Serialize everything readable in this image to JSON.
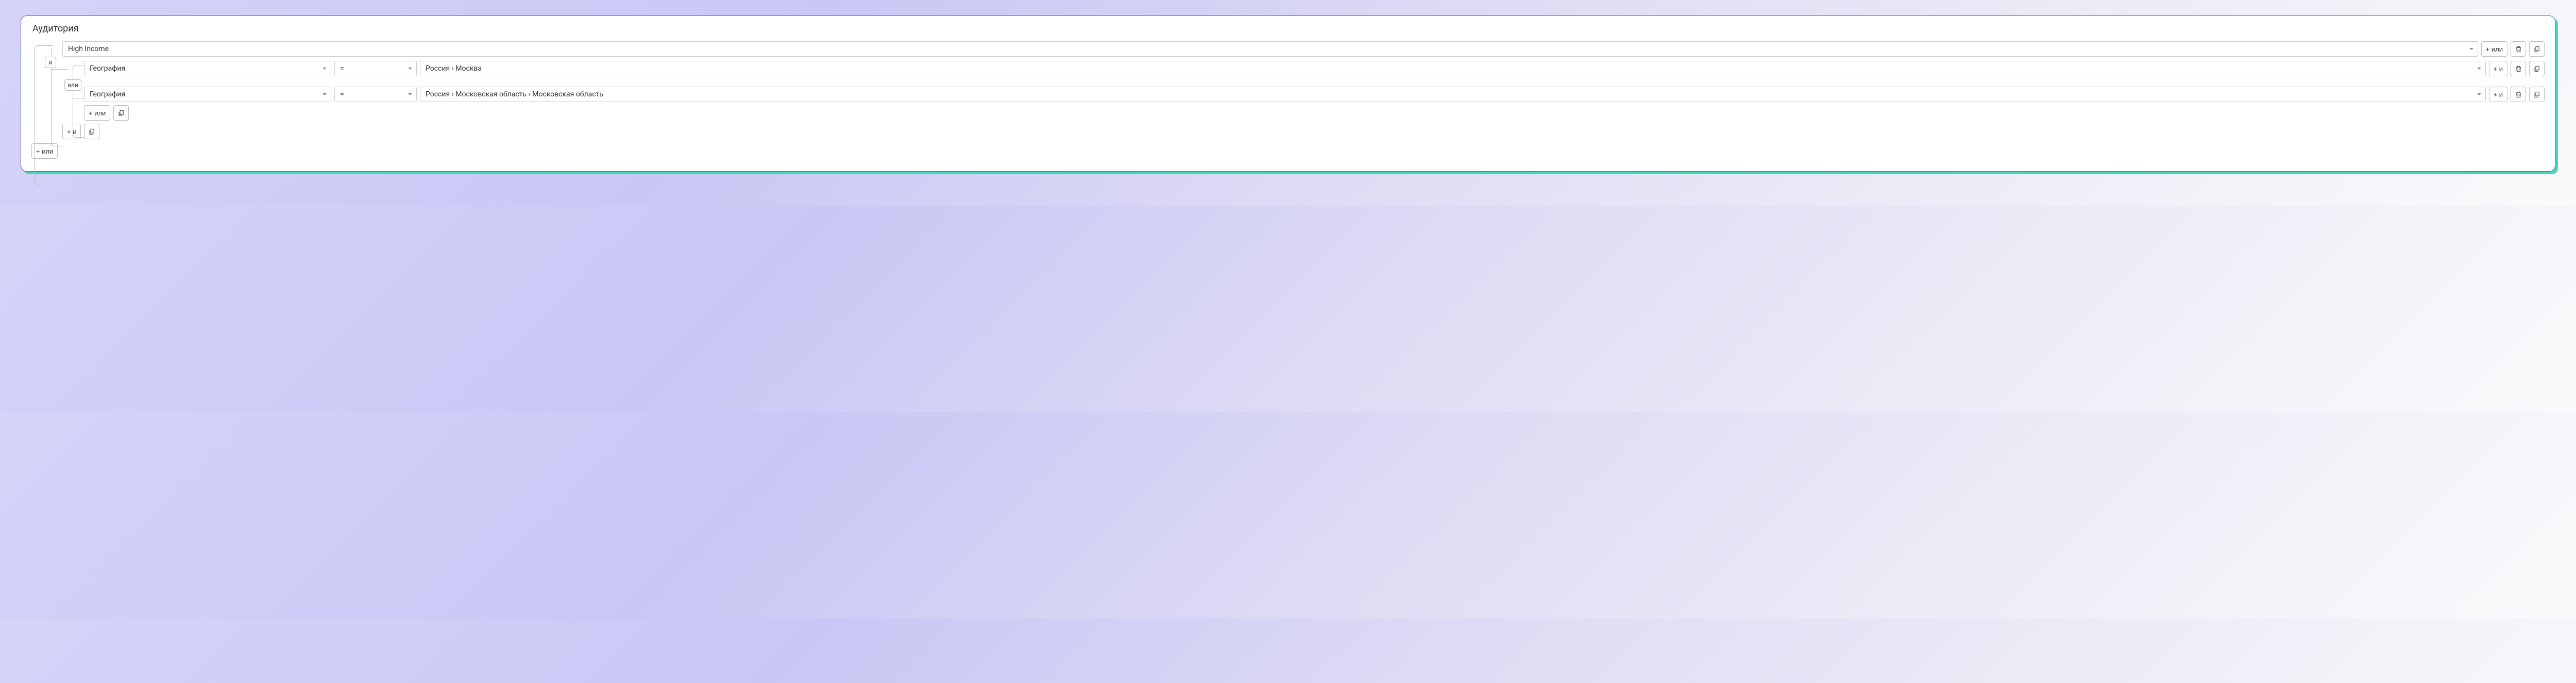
{
  "panel": {
    "title": "Аудитория"
  },
  "segment": {
    "value": "High Income"
  },
  "join": {
    "and": "и",
    "or": "или"
  },
  "rules": [
    {
      "field": "География",
      "op": "=",
      "value": "Россия › Москва"
    },
    {
      "field": "География",
      "op": "=",
      "value": "Россия › Московская область › Московская область"
    }
  ],
  "buttons": {
    "add_or": "+ или",
    "add_and": "+ и"
  }
}
